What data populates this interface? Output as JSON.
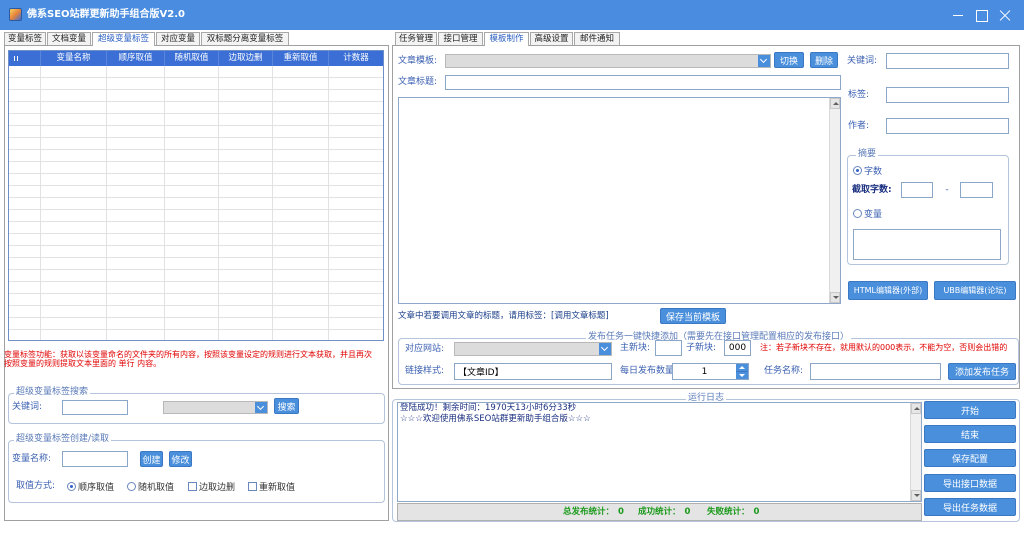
{
  "window": {
    "title": "佛系SEO站群更新助手组合版V2.0"
  },
  "colors": {
    "titlebar": "#4a8de0",
    "accent": "#4a8fdc",
    "table_header": "#3b6fd6",
    "warning": "#e00000",
    "stats": "#1a9a1a",
    "label": "#3a5fb0"
  },
  "icons": {
    "app": "app-icon",
    "minimize": "minimize-icon",
    "maximize": "maximize-icon",
    "close": "close-icon",
    "dropdown": "chevron-down-icon",
    "scroll_up": "scroll-up-icon",
    "scroll_down": "scroll-down-icon"
  },
  "left_tabs": [
    {
      "label": "变量标签",
      "active": false
    },
    {
      "label": "文档变量",
      "active": false
    },
    {
      "label": "超级变量标签",
      "active": true
    },
    {
      "label": "对应变量",
      "active": false
    },
    {
      "label": "双标题分离变量标签",
      "active": false
    }
  ],
  "variable_table": {
    "columns": [
      "变量名称",
      "顺序取值",
      "随机取值",
      "边取边删",
      "重新取值",
      "计数器"
    ],
    "rows": []
  },
  "variable_note": {
    "line1": "变量标签功能：获取以该变量命名的文件夹的所有内容，按照该变量设定的规则进行文本获取，并且再次",
    "line2": "按照变量的规则提取文本里面的 单行 内容。"
  },
  "search_group": {
    "title": "超级变量标签搜索",
    "keyword_label": "关键词:",
    "search_button": "搜索"
  },
  "create_group": {
    "title": "超级变量标签创建/读取",
    "name_label": "变量名称:",
    "create_button": "创建",
    "edit_button": "修改",
    "mode_label": "取值方式:",
    "options": [
      {
        "label": "顺序取值",
        "kind": "radio",
        "checked": true
      },
      {
        "label": "随机取值",
        "kind": "radio",
        "checked": false
      },
      {
        "label": "边取边删",
        "kind": "checkbox",
        "checked": false
      },
      {
        "label": "重新取值",
        "kind": "checkbox",
        "checked": false
      }
    ]
  },
  "right_tabs": [
    {
      "label": "任务管理",
      "active": false
    },
    {
      "label": "接口管理",
      "active": false
    },
    {
      "label": "模板制作",
      "active": true
    },
    {
      "label": "高级设置",
      "active": false
    },
    {
      "label": "邮件通知",
      "active": false
    }
  ],
  "template_editor": {
    "template_label": "文章模板:",
    "switch_button": "切换",
    "delete_button": "删除",
    "keyword_label": "关键词:",
    "title_label": "文章标题:",
    "tags_label": "标签:",
    "author_label": "作者:",
    "html_editor_button": "HTML编辑器(外部)",
    "ubb_editor_button": "UBB编辑器(论坛)",
    "hint": "文章中若要调用文章的标题，请用标签：[调用文章标题]",
    "save_template_button": "保存当前模板"
  },
  "abstract_group": {
    "title": "摘要",
    "options": [
      {
        "label": "字数",
        "checked": true
      },
      {
        "label": "变量",
        "checked": false
      }
    ],
    "length_label": "截取字数:",
    "range_separator": "-"
  },
  "publish_group": {
    "title": "发布任务一键快捷添加（需要先在接口管理配置相应的发布接口）",
    "site_label": "对应网站:",
    "main_block_label": "主新块:",
    "sub_block_label": "子新块:",
    "sub_block_value": "000",
    "note": "注：若子新块不存在，就用默认的000表示，不能为空，否则会出错的",
    "link_style_label": "链接样式:",
    "link_style_value": "【文章ID】",
    "daily_count_label": "每日发布数量:",
    "daily_count_value": "1",
    "task_name_label": "任务名称:",
    "add_button": "添加发布任务"
  },
  "log_group": {
    "title": "运行日志",
    "lines": [
      "登陆成功！剩余时间：1970天13小时6分33秒",
      "☆☆☆欢迎使用佛系SEO站群更新助手组合版☆☆☆"
    ],
    "stats": {
      "total_label": "总发布统计：",
      "total_value": "0",
      "success_label": "成功统计：",
      "success_value": "0",
      "fail_label": "失败统计：",
      "fail_value": "0"
    },
    "buttons": {
      "start": "开始",
      "stop": "结束",
      "save_config": "保存配置",
      "export_api": "导出接口数据",
      "export_tasks": "导出任务数据"
    }
  }
}
